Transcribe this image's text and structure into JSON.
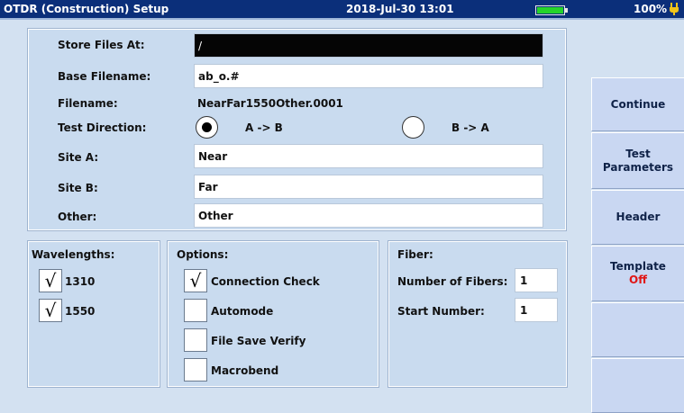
{
  "titlebar": {
    "title": "OTDR (Construction) Setup",
    "datetime": "2018-Jul-30 13:01",
    "battery_percent": "100%",
    "battery_fill": 1.0
  },
  "form": {
    "store_label": "Store Files At:",
    "store_value": "/",
    "base_label": "Base Filename:",
    "base_value": "ab_o.#",
    "filename_label": "Filename:",
    "filename_value": "NearFar1550Other.0001",
    "direction_label": "Test Direction:",
    "direction_ab": "A -> B",
    "direction_ba": "B -> A",
    "direction_selected": "A -> B",
    "site_a_label": "Site A:",
    "site_a_value": "Near",
    "site_b_label": "Site B:",
    "site_b_value": "Far",
    "other_label": "Other:",
    "other_value": "Other"
  },
  "wavelengths": {
    "title": "Wavelengths:",
    "items": [
      {
        "label": "1310",
        "checked": true,
        "mark": "√"
      },
      {
        "label": "1550",
        "checked": true,
        "mark": "√"
      }
    ]
  },
  "options": {
    "title": "Options:",
    "items": [
      {
        "label": "Connection Check",
        "checked": true,
        "mark": "√"
      },
      {
        "label": "Automode",
        "checked": false,
        "mark": ""
      },
      {
        "label": "File Save Verify",
        "checked": false,
        "mark": ""
      },
      {
        "label": "Macrobend",
        "checked": false,
        "mark": ""
      }
    ]
  },
  "fiber": {
    "title": "Fiber:",
    "num_label": "Number of Fibers:",
    "num_value": "1",
    "start_label": "Start Number:",
    "start_value": "1"
  },
  "sidebar": {
    "continue": "Continue",
    "test_params_1": "Test",
    "test_params_2": "Parameters",
    "header": "Header",
    "template": "Template",
    "template_state": "Off"
  },
  "colors": {
    "titlebar": "#0b2f7a",
    "background": "#d3e1f1",
    "panel": "#c9dbef",
    "sidebar_button": "#c9d7f2",
    "battery": "#25d42a",
    "off_state": "#e01616"
  },
  "icons": [
    "battery-icon",
    "plug-icon",
    "checkmark-icon"
  ]
}
